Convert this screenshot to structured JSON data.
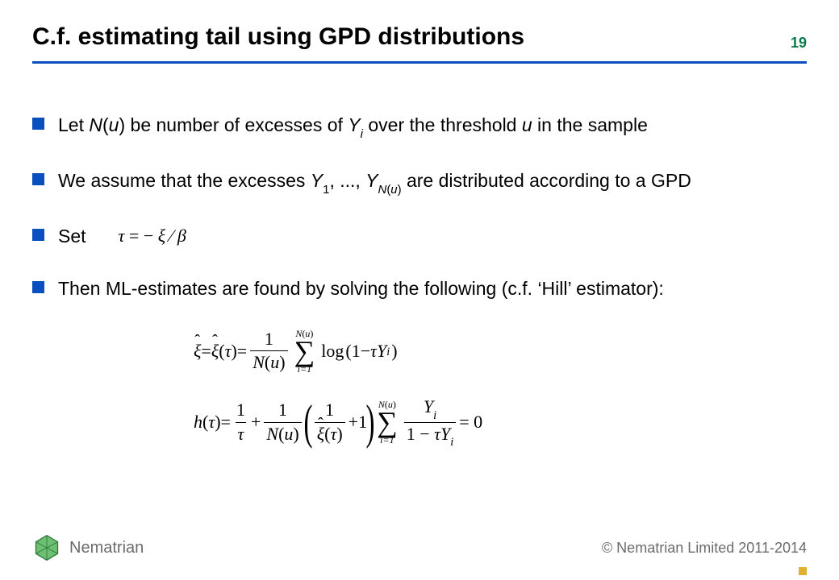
{
  "header": {
    "title": "C.f. estimating tail using GPD distributions",
    "page_number": "19"
  },
  "bullets": {
    "b1_pre": "Let ",
    "b1_Nofu": "N",
    "b1_paren_open": "(",
    "b1_u": "u",
    "b1_paren_close": ")",
    "b1_mid": " be number of excesses of ",
    "b1_Y": "Y",
    "b1_i": "i",
    "b1_post": " over the threshold ",
    "b1_u2": "u",
    "b1_end": " in the sample",
    "b2_pre": "We assume that the excesses ",
    "b2_Y": "Y",
    "b2_1": "1",
    "b2_dots": ", ..., ",
    "b2_Y2": "Y",
    "b2_Nu_N": "N",
    "b2_Nu_po": "(",
    "b2_Nu_u": "u",
    "b2_Nu_pc": ")",
    "b2_post": " are distributed according to a GPD",
    "b3_label": "Set",
    "b3_formula_tau": "τ",
    "b3_formula_eq": " = − ",
    "b3_formula_xi": "ξ",
    "b3_formula_slash": " ⁄ ",
    "b3_formula_beta": "β",
    "b4_text": "Then ML-estimates are found by solving the following (c.f. ‘Hill’ estimator):"
  },
  "equations": {
    "e1": {
      "xi_hat": "ξ",
      "eq1": " = ",
      "xi_hat2": "ξ",
      "of_tau_open": "(",
      "tau": "τ",
      "of_tau_close": ")",
      "eq2": " = ",
      "frac1_num": "1",
      "frac1_den_N": "N",
      "frac1_den_po": "(",
      "frac1_den_u": "u",
      "frac1_den_pc": ")",
      "sum_top_N": "N",
      "sum_top_po": "(",
      "sum_top_u": "u",
      "sum_top_pc": ")",
      "sum_bot": "i=1",
      "log": "log",
      "po": "(",
      "one": "1",
      "minus": " − ",
      "tau2": "τ",
      "Y": "Y",
      "i": "i",
      "pc": ")"
    },
    "e2": {
      "h": "h",
      "po": "(",
      "tau": "τ",
      "pc": ")",
      "eq": " = ",
      "frac1_num": "1",
      "frac1_den": "τ",
      "plus1": " + ",
      "frac2_num": "1",
      "frac2_den_N": "N",
      "frac2_den_po": "(",
      "frac2_den_u": "u",
      "frac2_den_pc": ")",
      "bp_open": "(",
      "frac3_num": "1",
      "frac3_den_xi": "ξ",
      "frac3_den_po": "(",
      "frac3_den_tau": "τ",
      "frac3_den_pc": ")",
      "plus2": " + ",
      "one": "1",
      "bp_close": ")",
      "sum_top_N": "N",
      "sum_top_po": "(",
      "sum_top_u": "u",
      "sum_top_pc": ")",
      "sum_bot": "i=1",
      "frac4_num_Y": "Y",
      "frac4_num_i": "i",
      "frac4_den_one": "1",
      "frac4_den_minus": " − ",
      "frac4_den_tau": "τ",
      "frac4_den_Y": "Y",
      "frac4_den_i": "i",
      "eqzero": " = 0"
    }
  },
  "footer": {
    "brand": "Nematrian",
    "copyright": "© Nematrian Limited 2011-2014"
  },
  "colors": {
    "rule_blue": "#0a4fbf",
    "accent_green": "#0a7a4b",
    "corner_gold": "#e0b030"
  }
}
